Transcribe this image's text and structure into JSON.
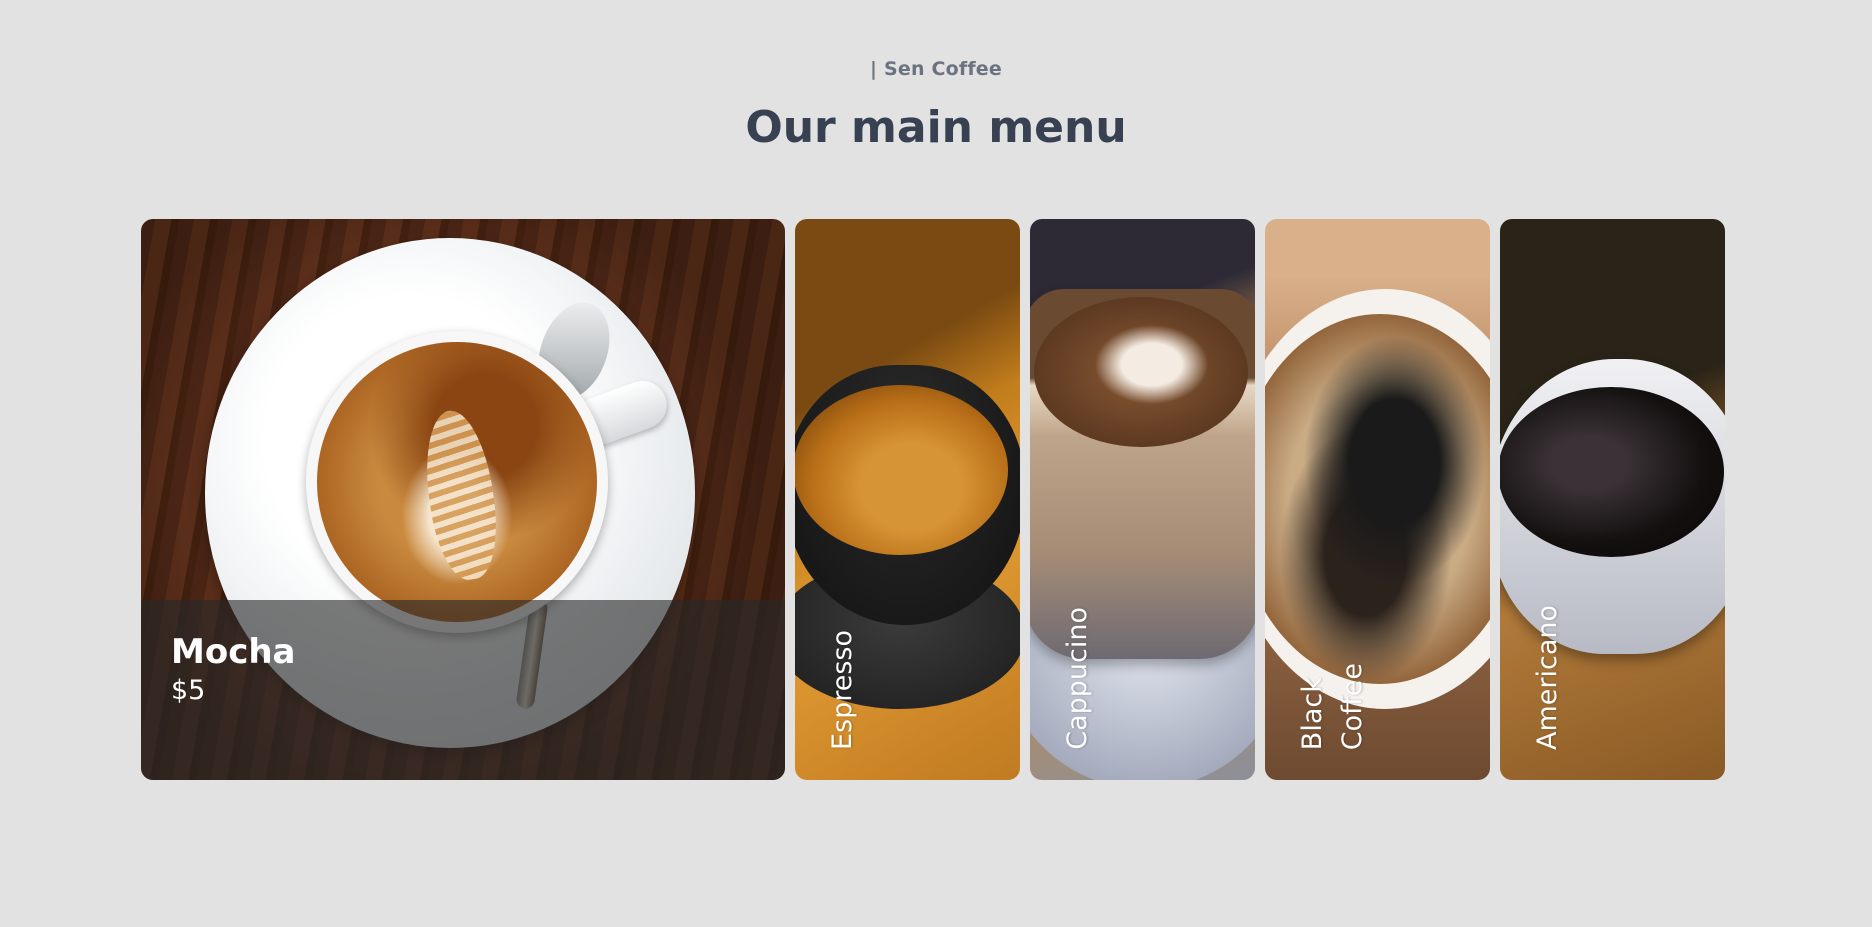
{
  "header": {
    "eyebrow": "| Sen Coffee",
    "title": "Our main menu"
  },
  "menu": {
    "items": [
      {
        "name": "Mocha",
        "price": "$5",
        "active": true
      },
      {
        "name": "Espresso",
        "active": false
      },
      {
        "name": "Cappucino",
        "active": false
      },
      {
        "name": "Black\nCoffee",
        "active": false
      },
      {
        "name": "Americano",
        "active": false
      }
    ]
  },
  "colors": {
    "background": "#e2e2e2",
    "eyebrow": "#6b7280",
    "title": "#374151",
    "label": "#ffffff"
  }
}
